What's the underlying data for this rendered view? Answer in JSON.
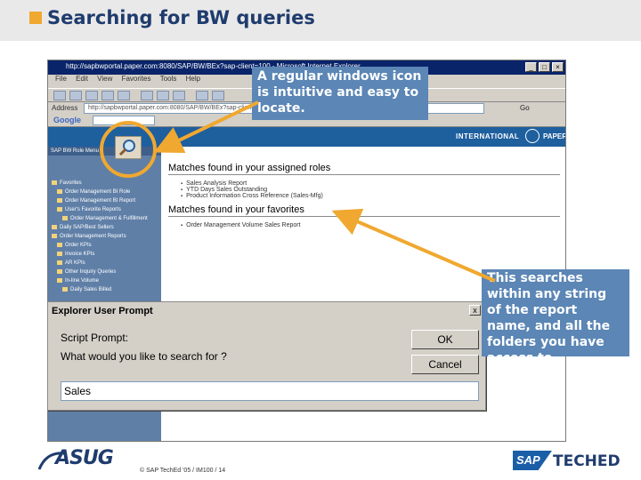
{
  "header": {
    "title": "Searching for BW queries"
  },
  "browser": {
    "window_title": "http://sapbwportal.paper.com:8080/SAP/BW/BEx?sap-client=100 - Microsoft Internet Explorer",
    "menu": [
      "File",
      "Edit",
      "View",
      "Favorites",
      "Tools",
      "Help"
    ],
    "address_label": "Address",
    "address_value": "http://sapbwportal.paper.com:8080/SAP/BW/BEx?sap-client=100&INDEX.htm",
    "go_label": "Go",
    "google_label": "Google"
  },
  "page": {
    "banner_text": "INTERNATIONAL",
    "banner_text2": "PAPER",
    "tree_header": "SAP BW Role Menu",
    "tree_items": [
      "Favorites",
      "Order Management BI Role",
      "Order Management BI Report",
      "User's Favorite Reports",
      "Order Management & Fulfillment",
      "Daily SAP/Best Sellers",
      "Order Management Reports",
      "Order KPIs",
      "Invoice KPIs",
      "AR KPIs",
      "Other Inquiry Queries",
      "In-line Volume",
      "Daily Sales Billed"
    ],
    "assigned_roles_title": "Matches found in your assigned roles",
    "assigned_roles_items": [
      "Sales Analysis Report",
      "YTD Days Sales Outstanding",
      "Product Information Cross Reference (Sales-Mfg)"
    ],
    "favorites_title": "Matches found in your favorites",
    "favorites_items": [
      "Order Management Volume Sales Report"
    ]
  },
  "dialog": {
    "title": "Explorer User Prompt",
    "close_label": "x",
    "prompt_label": "Script Prompt:",
    "question": "What would you like to search for ?",
    "ok_label": "OK",
    "cancel_label": "Cancel",
    "input_value": "Sales"
  },
  "callouts": {
    "icon_note": "A regular windows icon is intuitive and easy to locate.",
    "search_note": "This searches within any string of the report name, and all the folders you have access to"
  },
  "footer": {
    "asug": "ASUG",
    "copyright": "© SAP TechEd '05 / IM100 / 14",
    "sap": "SAP",
    "teched": "TECHED"
  },
  "colors": {
    "header_accent": "#f0a830",
    "title_text": "#1f3c6e",
    "callout_bg": "#5b86b5",
    "highlight_circle": "#f0a830"
  }
}
